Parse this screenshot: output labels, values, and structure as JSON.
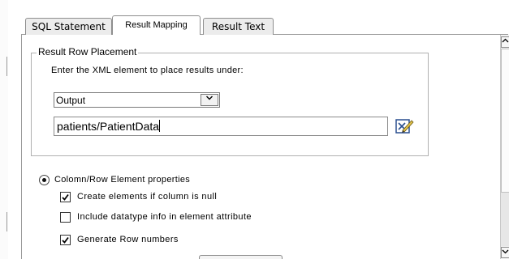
{
  "tabs": [
    {
      "label": "SQL Statement",
      "active": false
    },
    {
      "label": "Result Mapping",
      "active": true
    },
    {
      "label": "Result Text",
      "active": false
    }
  ],
  "group": {
    "title": "Result Row Placement",
    "instruction": "Enter the XML element to place results under:",
    "select_value": "Output",
    "path_value": "patients/PatientData"
  },
  "options": {
    "radio_label": "Colomn/Row Element properties",
    "checkboxes": [
      {
        "label": "Create elements if column is null",
        "checked": true
      },
      {
        "label": "Include datatype info in element attribute",
        "checked": false
      },
      {
        "label": "Generate Row numbers",
        "checked": true
      }
    ]
  },
  "icons": {
    "edit_button": "edit-pencil-icon",
    "scroll_up": "scroll-up-arrow-icon",
    "scroll_down": "scroll-down-arrow-icon",
    "dropdown": "chevron-down-icon"
  }
}
